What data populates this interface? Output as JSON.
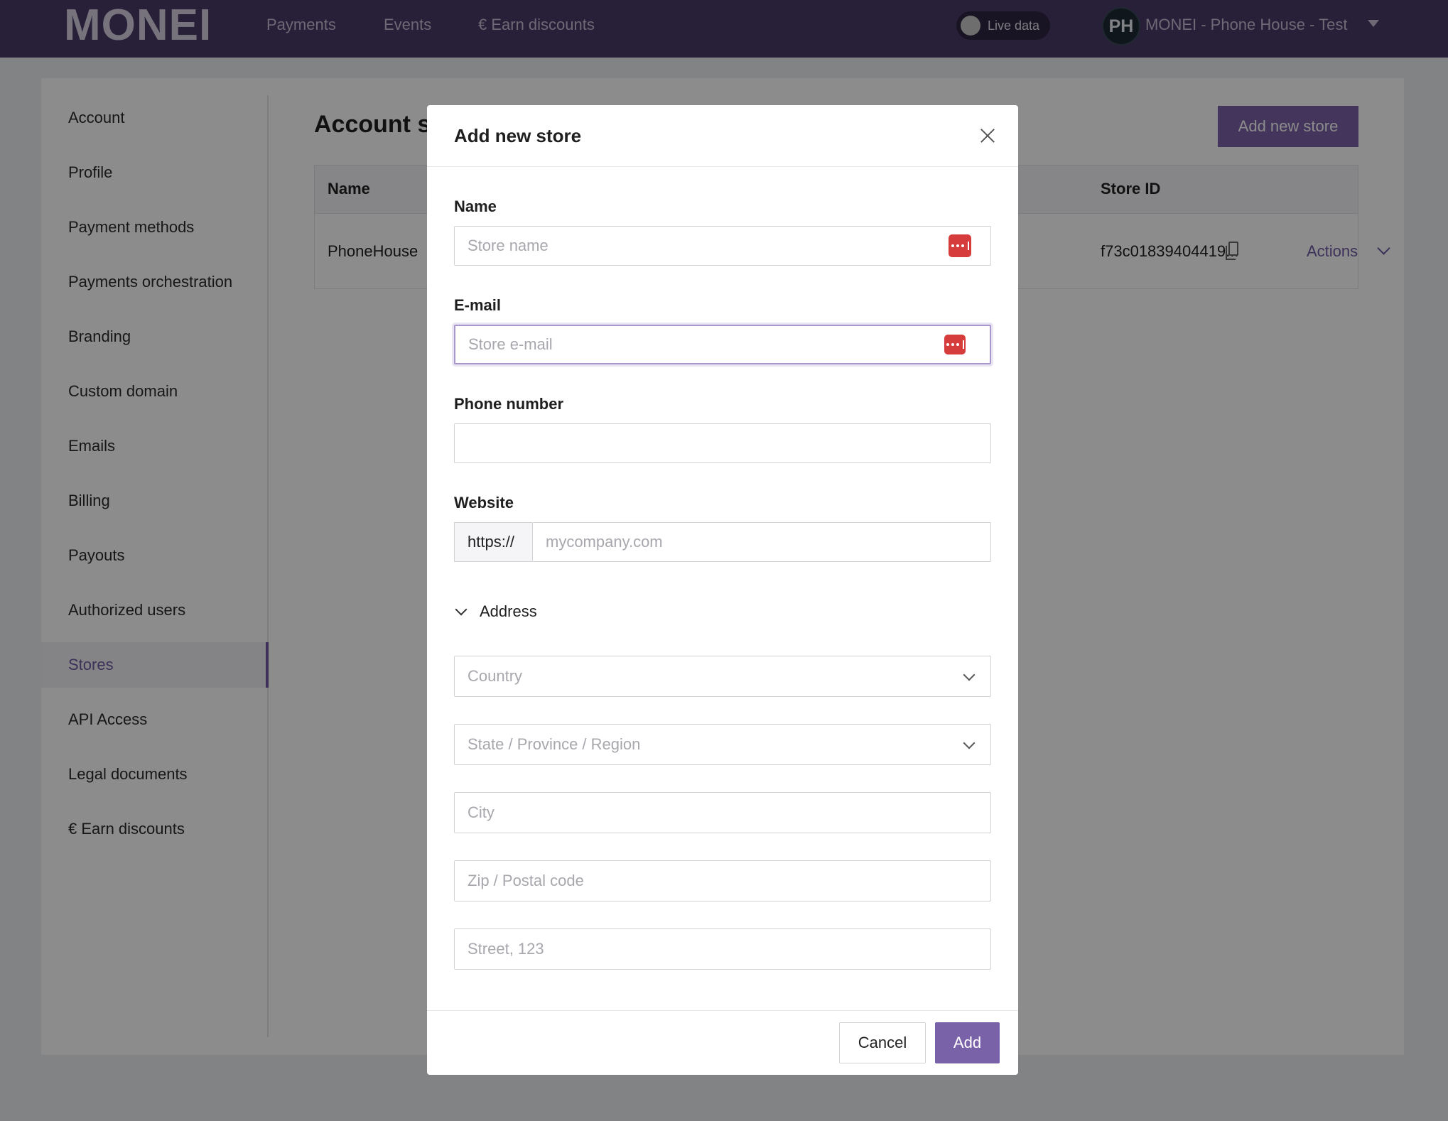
{
  "header": {
    "logo": "MONEI",
    "nav": [
      "Payments",
      "Events",
      "€ Earn discounts"
    ],
    "live_label": "Live data",
    "avatar_initials": "PH",
    "account_name": "MONEI - Phone House - Test"
  },
  "sidebar": {
    "items": [
      "Account",
      "Profile",
      "Payment methods",
      "Payments orchestration",
      "Branding",
      "Custom domain",
      "Emails",
      "Billing",
      "Payouts",
      "Authorized users",
      "Stores",
      "API Access",
      "Legal documents",
      "€ Earn discounts"
    ],
    "active": "Stores"
  },
  "main": {
    "title": "Account st",
    "add_button": "Add new store",
    "table": {
      "headers": [
        "Name",
        "Store ID"
      ],
      "rows": [
        {
          "name": "PhoneHouse",
          "store_id": "f73c01839404419...",
          "actions": "Actions"
        }
      ]
    }
  },
  "modal": {
    "title": "Add new store",
    "name_label": "Name",
    "name_placeholder": "Store name",
    "email_label": "E-mail",
    "email_placeholder": "Store e-mail",
    "phone_label": "Phone number",
    "website_label": "Website",
    "website_prefix": "https://",
    "website_placeholder": "mycompany.com",
    "address_label": "Address",
    "country_placeholder": "Country",
    "state_placeholder": "State / Province / Region",
    "city_placeholder": "City",
    "zip_placeholder": "Zip / Postal code",
    "street_placeholder": "Street, 123",
    "cancel": "Cancel",
    "add": "Add"
  },
  "colors": {
    "topbar": "#4a3a69",
    "accent": "#7a62a8",
    "password_manager": "#d63c3c"
  },
  "icons": [
    "close-icon",
    "password-manager-icon",
    "chevron-down-icon",
    "copy-icon",
    "caret-down-icon"
  ]
}
